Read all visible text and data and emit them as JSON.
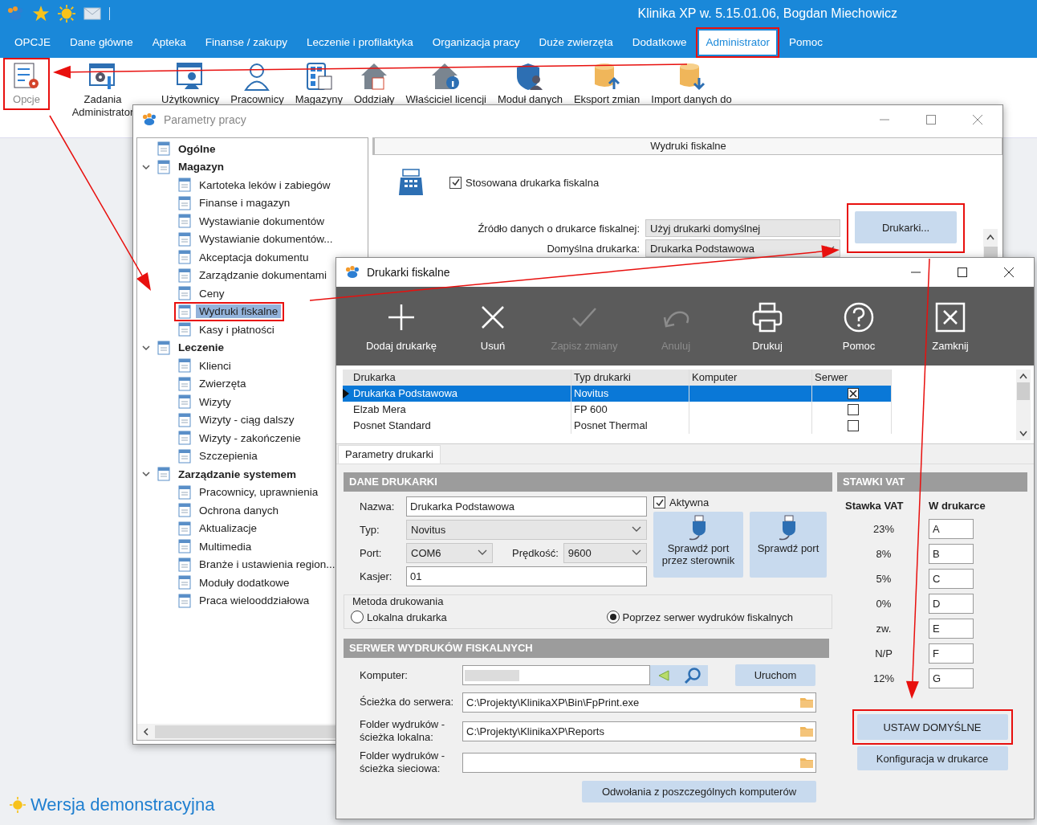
{
  "app": {
    "title": "Klinika XP w. 5.15.01.06, Bogdan Miechowicz",
    "menu": [
      {
        "label": "OPCJE",
        "selected": false,
        "annotated": false
      },
      {
        "label": "Dane główne",
        "selected": false,
        "annotated": false
      },
      {
        "label": "Apteka",
        "selected": false,
        "annotated": false
      },
      {
        "label": "Finanse / zakupy",
        "selected": false,
        "annotated": false
      },
      {
        "label": "Leczenie i profilaktyka",
        "selected": false,
        "annotated": false
      },
      {
        "label": "Organizacja pracy",
        "selected": false,
        "annotated": false
      },
      {
        "label": "Duże zwierzęta",
        "selected": false,
        "annotated": false
      },
      {
        "label": "Dodatkowe",
        "selected": false,
        "annotated": false
      },
      {
        "label": "Administrator",
        "selected": true,
        "annotated": true
      },
      {
        "label": "Pomoc",
        "selected": false,
        "annotated": false
      }
    ],
    "ribbon": [
      {
        "label": "Opcje",
        "disabled": true,
        "annotated": true
      },
      {
        "label": "Zadania Administrator",
        "disabled": false,
        "annotated": false
      },
      {
        "label": "Użytkownicy",
        "disabled": false,
        "annotated": false
      },
      {
        "label": "Pracownicy",
        "disabled": false,
        "annotated": false
      },
      {
        "label": "Magazyny",
        "disabled": false,
        "annotated": false
      },
      {
        "label": "Oddziały",
        "disabled": false,
        "annotated": false
      },
      {
        "label": "Właściciel licencji",
        "disabled": false,
        "annotated": false
      },
      {
        "label": "Moduł danych",
        "disabled": false,
        "annotated": false
      },
      {
        "label": "Eksport zmian",
        "disabled": false,
        "annotated": false
      },
      {
        "label": "Import danych do",
        "disabled": false,
        "annotated": false
      }
    ],
    "demo_label": "Wersja demonstracyjna"
  },
  "params_window": {
    "title": "Parametry pracy",
    "tree": [
      {
        "label": "Ogólne",
        "selected": false,
        "annotated": false
      },
      {
        "label": "Magazyn",
        "selected": false,
        "annotated": false,
        "expanded": true,
        "children": [
          {
            "label": "Kartoteka leków i zabiegów",
            "selected": false,
            "annotated": false
          },
          {
            "label": "Finanse i magazyn",
            "selected": false,
            "annotated": false
          },
          {
            "label": "Wystawianie dokumentów",
            "selected": false,
            "annotated": false
          },
          {
            "label": "Wystawianie dokumentów...",
            "selected": false,
            "annotated": false
          },
          {
            "label": "Akceptacja dokumentu",
            "selected": false,
            "annotated": false
          },
          {
            "label": "Zarządzanie dokumentami",
            "selected": false,
            "annotated": false
          },
          {
            "label": "Ceny",
            "selected": false,
            "annotated": false
          },
          {
            "label": "Wydruki fiskalne",
            "selected": true,
            "annotated": true
          },
          {
            "label": "Kasy i płatności",
            "selected": false,
            "annotated": false
          }
        ]
      },
      {
        "label": "Leczenie",
        "selected": false,
        "annotated": false,
        "expanded": true,
        "children": [
          {
            "label": "Klienci",
            "selected": false,
            "annotated": false
          },
          {
            "label": "Zwierzęta",
            "selected": false,
            "annotated": false
          },
          {
            "label": "Wizyty",
            "selected": false,
            "annotated": false
          },
          {
            "label": "Wizyty - ciąg dalszy",
            "selected": false,
            "annotated": false
          },
          {
            "label": "Wizyty - zakończenie",
            "selected": false,
            "annotated": false
          },
          {
            "label": "Szczepienia",
            "selected": false,
            "annotated": false
          }
        ]
      },
      {
        "label": "Zarządzanie systemem",
        "selected": false,
        "annotated": false,
        "expanded": true,
        "children": [
          {
            "label": "Pracownicy, uprawnienia",
            "selected": false,
            "annotated": false
          },
          {
            "label": "Ochrona danych",
            "selected": false,
            "annotated": false
          },
          {
            "label": "Aktualizacje",
            "selected": false,
            "annotated": false
          },
          {
            "label": "Multimedia",
            "selected": false,
            "annotated": false
          },
          {
            "label": "Branże i ustawienia region...",
            "selected": false,
            "annotated": false
          },
          {
            "label": "Moduły dodatkowe",
            "selected": false,
            "annotated": false
          },
          {
            "label": "Praca wielooddziałowa",
            "selected": false,
            "annotated": false
          }
        ]
      }
    ],
    "section_title": "Wydruki fiskalne",
    "use_printer": {
      "label": "Stosowana drukarka fiskalna",
      "checked": true
    },
    "source": {
      "label": "Źródło danych o drukarce fiskalnej:",
      "value": "Użyj drukarki domyślnej"
    },
    "default_printer": {
      "label": "Domyślna drukarka:",
      "value": "Drukarka Podstawowa"
    },
    "printers_button": {
      "label": "Drukarki...",
      "annotated": true
    }
  },
  "printers_window": {
    "title": "Drukarki fiskalne",
    "toolbar": [
      {
        "label": "Dodaj drukarkę",
        "disabled": false
      },
      {
        "label": "Usuń",
        "disabled": false
      },
      {
        "label": "Zapisz zmiany",
        "disabled": true
      },
      {
        "label": "Anuluj",
        "disabled": true
      },
      {
        "label": "Drukuj",
        "disabled": false
      },
      {
        "label": "Pomoc",
        "disabled": false
      },
      {
        "label": "Zamknij",
        "disabled": false
      }
    ],
    "grid": {
      "columns": [
        "Drukarka",
        "Typ drukarki",
        "Komputer",
        "Serwer"
      ],
      "rows": [
        {
          "name": "Drukarka Podstawowa",
          "type": "Novitus",
          "current": true,
          "selected": true,
          "server": true
        },
        {
          "name": "Elzab Mera",
          "type": "FP 600",
          "current": false,
          "selected": false,
          "server": false
        },
        {
          "name": "Posnet Standard",
          "type": "Posnet Thermal",
          "current": false,
          "selected": false,
          "server": false
        }
      ]
    },
    "tabs": [
      {
        "label": "Parametry drukarki",
        "selected": true
      }
    ],
    "printer_data": {
      "header": "DANE DRUKARKI",
      "name": {
        "label": "Nazwa:",
        "value": "Drukarka Podstawowa"
      },
      "type": {
        "label": "Typ:",
        "value": "Novitus"
      },
      "port": {
        "label": "Port:",
        "value": "COM6"
      },
      "speed": {
        "label": "Prędkość:",
        "value": "9600"
      },
      "cashier": {
        "label": "Kasjer:",
        "value": "01"
      },
      "active": {
        "label": "Aktywna",
        "checked": true
      },
      "port_buttons": [
        "Sprawdź port przez sterownik",
        "Sprawdź port"
      ]
    },
    "print_method": {
      "label": "Metoda drukowania",
      "options": [
        {
          "label": "Lokalna drukarka",
          "selected": false
        },
        {
          "label": "Poprzez serwer wydruków fiskalnych",
          "selected": true
        }
      ]
    },
    "server": {
      "header": "SERWER WYDRUKÓW FISKALNYCH",
      "computer_label": "Komputer:",
      "start_button": "Uruchom",
      "paths": [
        {
          "label": "Ścieżka do serwera:",
          "value": "C:\\Projekty\\KlinikaXP\\Bin\\FpPrint.exe"
        },
        {
          "label": "Folder wydruków - ścieżka lokalna:",
          "value": "C:\\Projekty\\KlinikaXP\\Reports"
        },
        {
          "label": "Folder wydruków - ścieżka sieciowa:"
        }
      ],
      "calls_button": "Odwołania z poszczególnych komputerów"
    },
    "vat": {
      "header": "STAWKI VAT",
      "columns": [
        "Stawka VAT",
        "W drukarce"
      ],
      "rows": [
        {
          "rate": "23%",
          "code": "A"
        },
        {
          "rate": "8%",
          "code": "B"
        },
        {
          "rate": "5%",
          "code": "C"
        },
        {
          "rate": "0%",
          "code": "D"
        },
        {
          "rate": "zw.",
          "code": "E"
        },
        {
          "rate": "N/P",
          "code": "F"
        },
        {
          "rate": "12%",
          "code": "G"
        }
      ],
      "default_button": {
        "label": "USTAW DOMYŚLNE",
        "annotated": true
      },
      "config_button": "Konfiguracja w drukarce"
    }
  }
}
